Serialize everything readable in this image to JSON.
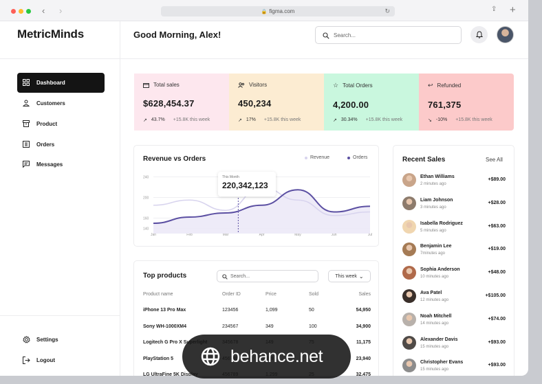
{
  "browser": {
    "url": "figma.com"
  },
  "app": {
    "name": "MetricMinds",
    "greeting": "Good Morning, Alex!"
  },
  "search": {
    "placeholder": "Search..."
  },
  "nav": {
    "items": [
      {
        "label": "Dashboard",
        "icon": "grid-icon",
        "active": true
      },
      {
        "label": "Customers",
        "icon": "user-icon"
      },
      {
        "label": "Product",
        "icon": "box-icon"
      },
      {
        "label": "Orders",
        "icon": "orders-icon"
      },
      {
        "label": "Messages",
        "icon": "message-icon"
      }
    ],
    "bottom": [
      {
        "label": "Settings",
        "icon": "gear-icon"
      },
      {
        "label": "Logout",
        "icon": "logout-icon"
      }
    ]
  },
  "stats": [
    {
      "title": "Total sales",
      "value": "$628,454.37",
      "change": "43.7%",
      "note": "+15.8K this week",
      "color": "#fde7ee"
    },
    {
      "title": "Visitors",
      "value": "450,234",
      "change": "17%",
      "note": "+15.8K this week",
      "color": "#fcecd2"
    },
    {
      "title": "Total Orders",
      "value": "4,200.00",
      "change": "30.34%",
      "note": "+15.8K this week",
      "color": "#c9f7de"
    },
    {
      "title": "Refunded",
      "value": "761,375",
      "change": "-10%",
      "note": "+15.8K this week",
      "color": "#fccaca"
    }
  ],
  "revenue": {
    "title": "Revenue vs Orders",
    "legend_revenue": "Revenue",
    "legend_orders": "Orders",
    "tooltip_label": "This Month",
    "tooltip_value": "220,342,123"
  },
  "chart_data": {
    "type": "line",
    "x": [
      "Jan",
      "Feb",
      "Mar",
      "Apr",
      "May",
      "Jun",
      "Jul"
    ],
    "y_ticks": [
      240,
      200,
      160,
      140
    ],
    "ylim": [
      130,
      250
    ],
    "series": [
      {
        "name": "Revenue",
        "values": [
          185,
          195,
          175,
          220,
          195,
          165,
          172
        ],
        "color": "#d8d4ee"
      },
      {
        "name": "Orders",
        "values": [
          150,
          162,
          170,
          185,
          215,
          172,
          183
        ],
        "color": "#5b4fa2"
      }
    ]
  },
  "top_products": {
    "title": "Top products",
    "search_placeholder": "Search...",
    "filter": "This week",
    "columns": [
      "Product name",
      "Order ID",
      "Price",
      "Sold",
      "Sales"
    ],
    "rows": [
      [
        "iPhone 13 Pro Max",
        "123456",
        "1,099",
        "50",
        "54,950"
      ],
      [
        "Sony WH-1000XM4",
        "234567",
        "349",
        "100",
        "34,900"
      ],
      [
        "Logitech G Pro X Superlight",
        "345678",
        "149",
        "75",
        "11,175"
      ],
      [
        "PlayStation 5",
        "456789",
        "499",
        "48",
        "23,940"
      ],
      [
        "LG UltraFine 5K Display",
        "456789",
        "1,299",
        "25",
        "32,475"
      ]
    ]
  },
  "recent_sales": {
    "title": "Recent Sales",
    "see_all": "See All",
    "items": [
      {
        "name": "Ethan Williams",
        "time": "2 minutes ago",
        "amount": "+$89.00"
      },
      {
        "name": "Liam Johnson",
        "time": "3 minutes ago",
        "amount": "+$28.00"
      },
      {
        "name": "Isabella Rodriguez",
        "time": "5 minutes ago",
        "amount": "+$63.00"
      },
      {
        "name": "Benjamin Lee",
        "time": "7minutes ago",
        "amount": "+$19.00"
      },
      {
        "name": "Sophia Anderson",
        "time": "10 minutes ago",
        "amount": "+$48.00"
      },
      {
        "name": "Ava Patel",
        "time": "12 minutes ago",
        "amount": "+$105.00"
      },
      {
        "name": "Noah Mitchell",
        "time": "14 minutes ago",
        "amount": "+$74.00"
      },
      {
        "name": "Alexander Davis",
        "time": "15 minutes ago",
        "amount": "+$93.00"
      },
      {
        "name": "Christopher Evans",
        "time": "15 minutes ago",
        "amount": "+$93.00"
      }
    ]
  },
  "watermark": {
    "text": "behance.net"
  }
}
